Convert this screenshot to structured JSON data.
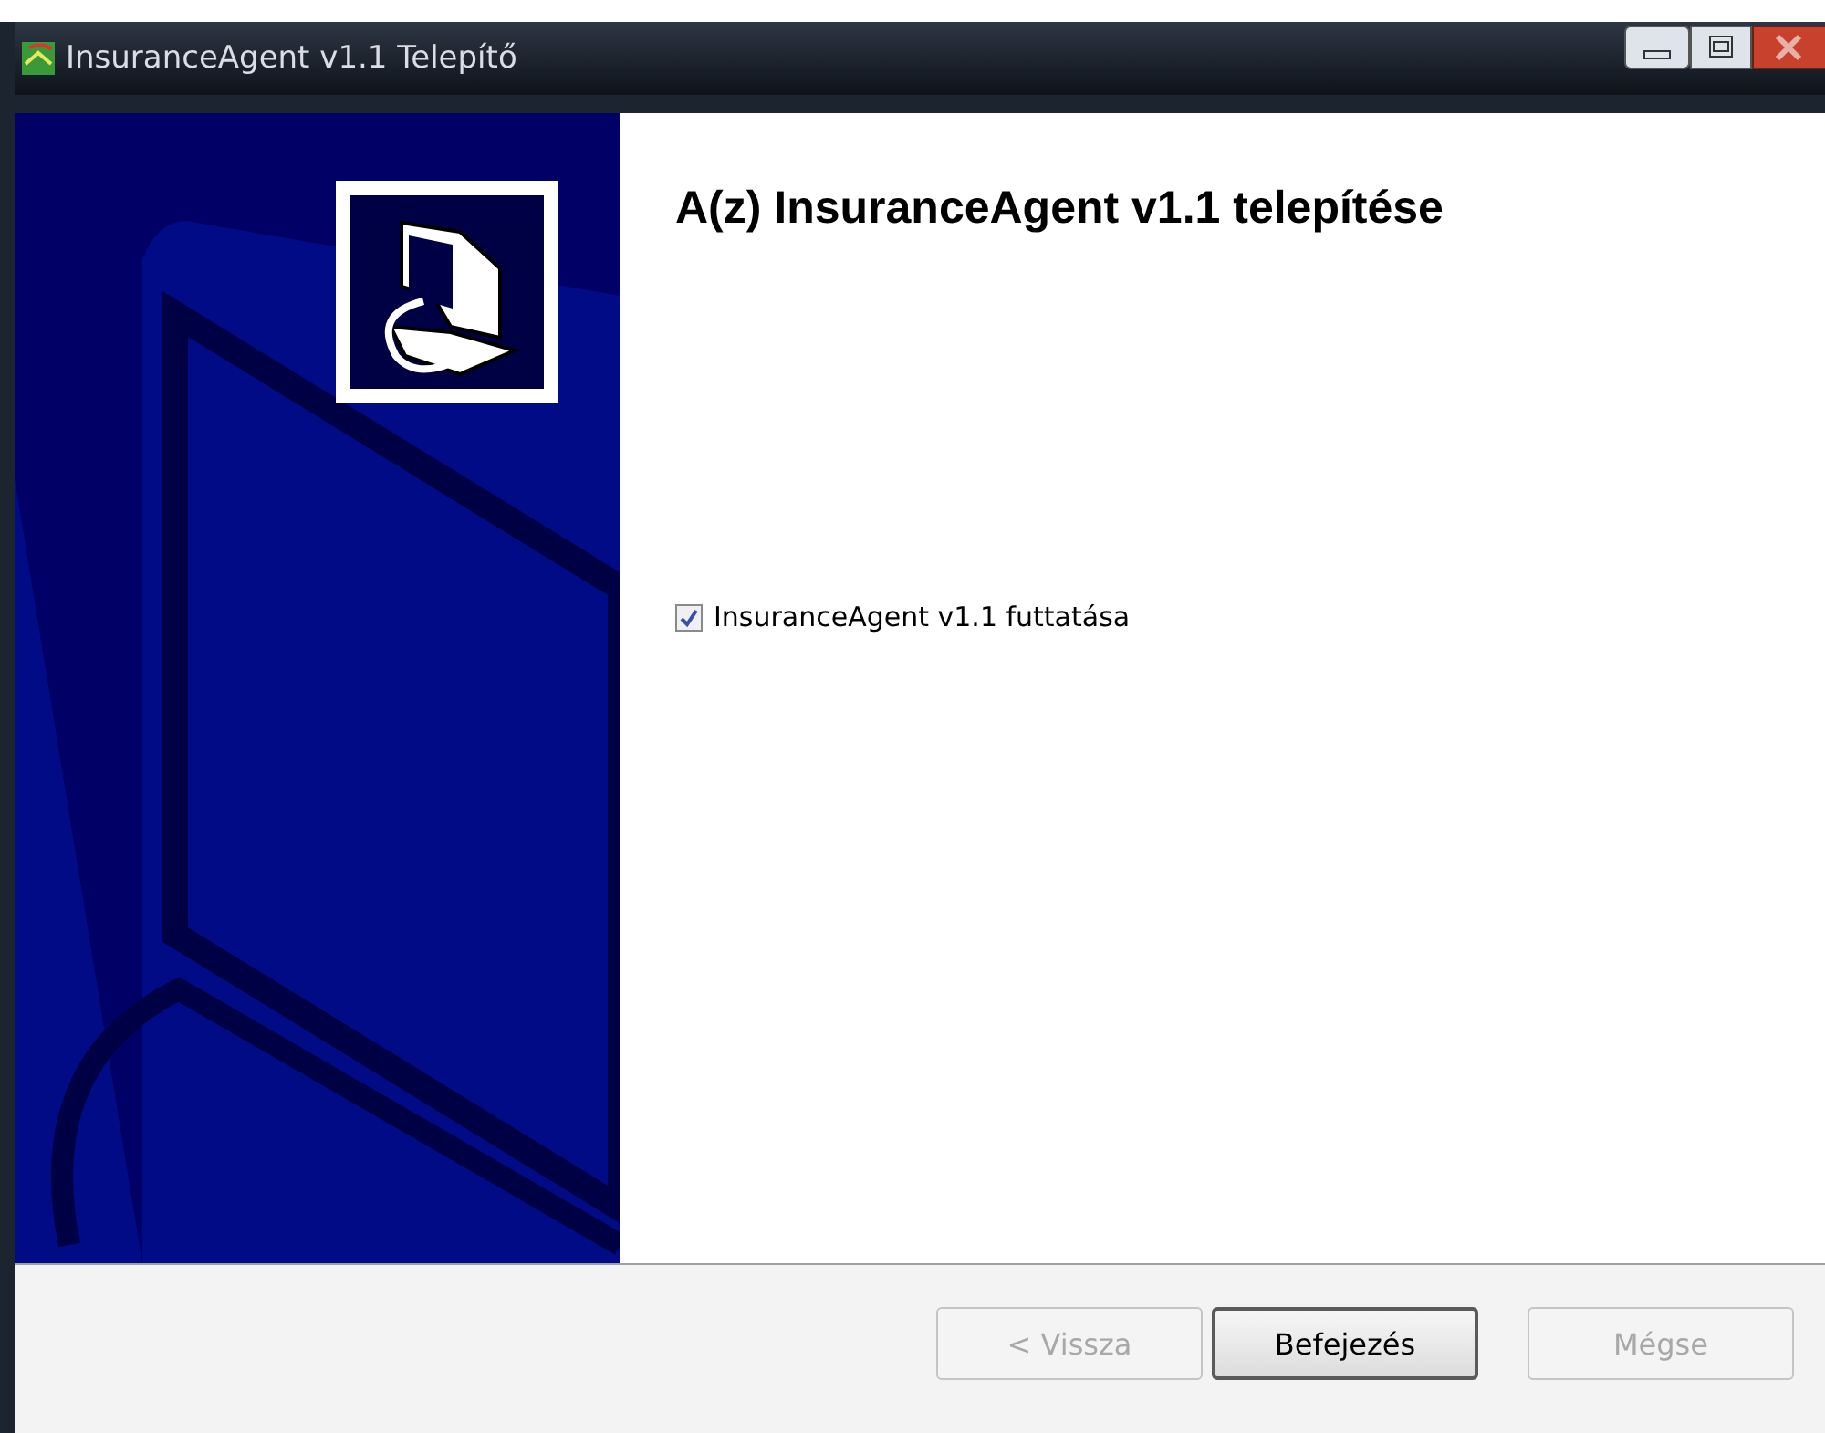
{
  "window": {
    "title": "InsuranceAgent v1.1 Telepítő"
  },
  "heading": "A(z) InsuranceAgent v1.1 telepítése",
  "options": [
    {
      "label": "InsuranceAgent v1.1 futtatása",
      "checked": true
    }
  ],
  "buttons": [
    {
      "label": "< Vissza",
      "disabled": true,
      "default": false
    },
    {
      "label": "Befejezés",
      "disabled": false,
      "default": true
    },
    {
      "label": "Mégse",
      "disabled": true,
      "default": false
    }
  ]
}
